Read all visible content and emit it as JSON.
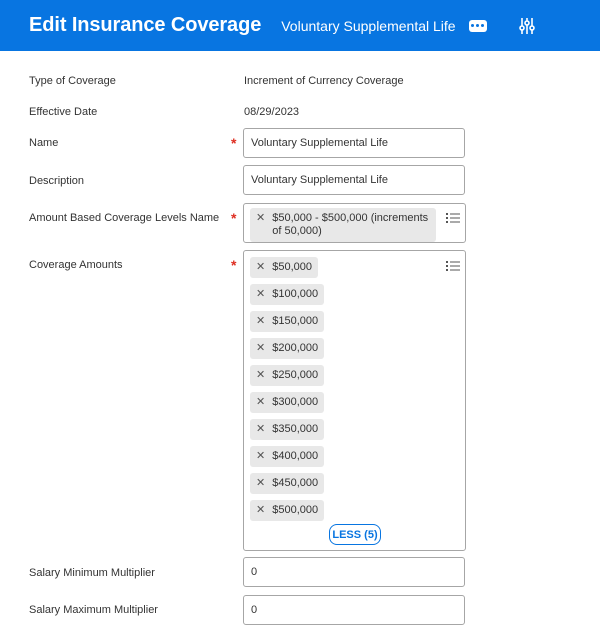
{
  "header": {
    "title": "Edit Insurance Coverage",
    "subtitle": "Voluntary Supplemental Life",
    "more_icon": "more-ellipsis-icon",
    "filter_icon": "sliders-icon",
    "background_color": "#0875e1"
  },
  "form": {
    "type_of_coverage": {
      "label": "Type of Coverage",
      "value": "Increment of Currency Coverage"
    },
    "effective_date": {
      "label": "Effective Date",
      "value": "08/29/2023"
    },
    "name": {
      "label": "Name",
      "value": "Voluntary Supplemental Life",
      "required_mark": "*"
    },
    "description": {
      "label": "Description",
      "value": "Voluntary Supplemental Life"
    },
    "amount_levels": {
      "label": "Amount Based Coverage Levels Name",
      "required_mark": "*",
      "chip_line1": "$50,000 - $500,000 (increments",
      "chip_line2": "of 50,000)"
    },
    "coverage_amounts": {
      "label": "Coverage Amounts",
      "required_mark": "*",
      "items": [
        "$50,000",
        "$100,000",
        "$150,000",
        "$200,000",
        "$250,000",
        "$300,000",
        "$350,000",
        "$400,000",
        "$450,000",
        "$500,000"
      ],
      "less_label": "LESS (5)"
    },
    "salary_min": {
      "label": "Salary Minimum Multiplier",
      "value": "0"
    },
    "salary_max": {
      "label": "Salary Maximum Multiplier",
      "value": "0"
    }
  },
  "colors": {
    "accent": "#0875e1",
    "required": "#de2e21",
    "chip_bg": "#e8e8e8"
  }
}
